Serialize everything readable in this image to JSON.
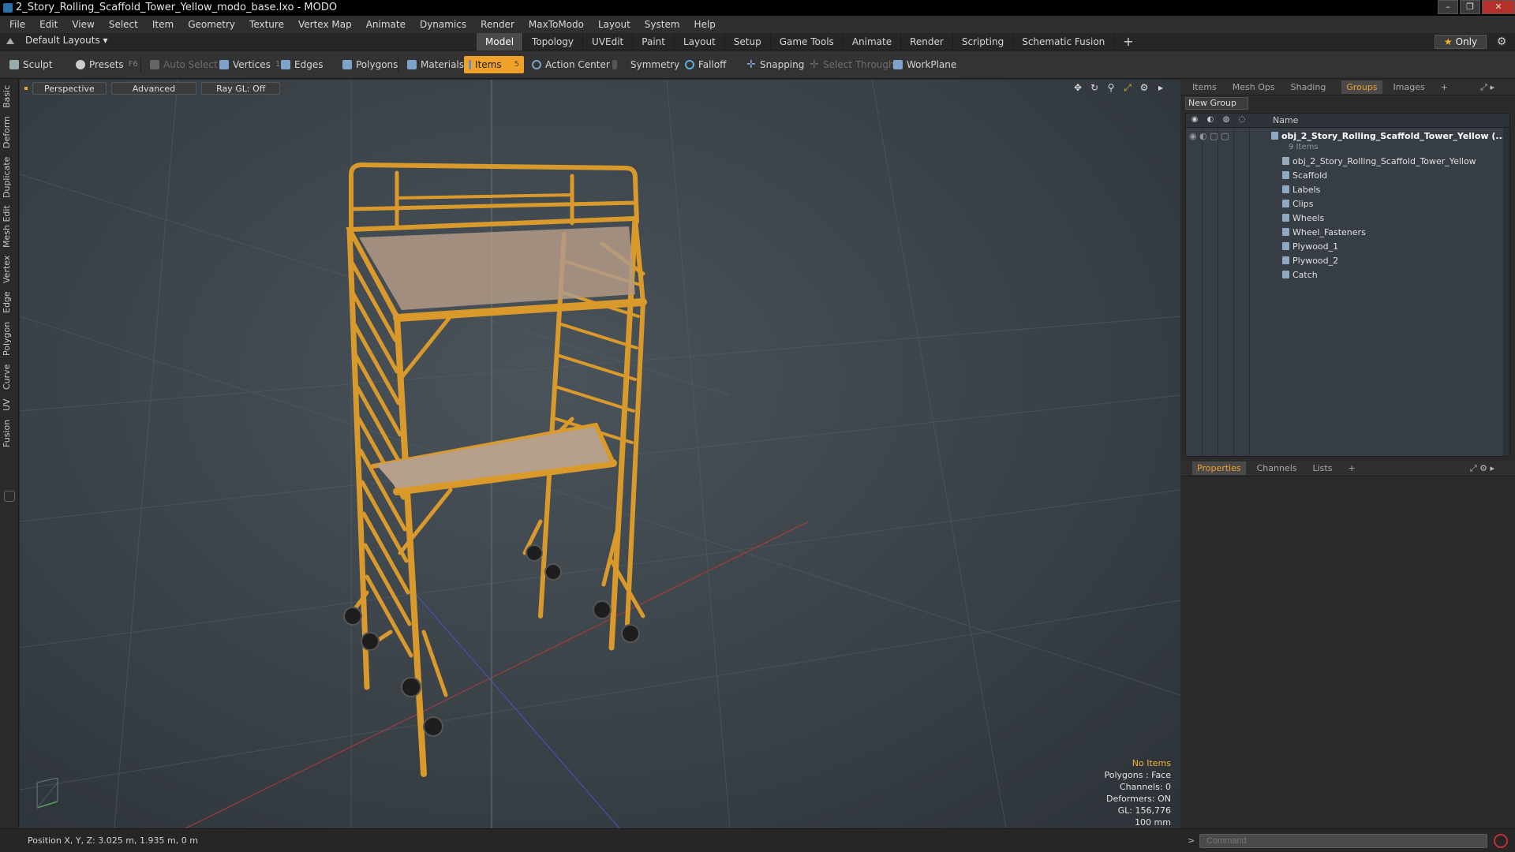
{
  "window": {
    "title": "2_Story_Rolling_Scaffold_Tower_Yellow_modo_base.lxo - MODO",
    "controls": [
      "–",
      "❐",
      "✕"
    ]
  },
  "menu": [
    "File",
    "Edit",
    "View",
    "Select",
    "Item",
    "Geometry",
    "Texture",
    "Vertex Map",
    "Animate",
    "Dynamics",
    "Render",
    "MaxToModo",
    "Layout",
    "System",
    "Help"
  ],
  "layouts": {
    "label": "Default Layouts ▾"
  },
  "mode_tabs": [
    "Model",
    "Topology",
    "UVEdit",
    "Paint",
    "Layout",
    "Setup",
    "Game Tools",
    "Animate",
    "Render",
    "Scripting",
    "Schematic Fusion",
    "+"
  ],
  "only_button": {
    "star": "★",
    "label": "Only"
  },
  "toolbar": {
    "sculpt": "Sculpt",
    "presets": "Presets",
    "presets_key": "F6",
    "auto_select": "Auto Select",
    "vertices": "Vertices",
    "vertices_key": "1",
    "edges": "Edges",
    "edges_key": "2",
    "polygons": "Polygons",
    "materials": "Materials",
    "items": "Items",
    "items_key": "5",
    "action_center": "Action Center",
    "symmetry": "Symmetry",
    "falloff": "Falloff",
    "snapping": "Snapping",
    "select_through": "Select Through",
    "workplane": "WorkPlane"
  },
  "left_tabs": [
    "Basic",
    "Deform",
    "Duplicate",
    "Mesh Edit",
    "Vertex",
    "Edge",
    "Polygon",
    "Curve",
    "UV",
    "Fusion"
  ],
  "viewport": {
    "buttons": [
      "Perspective",
      "Advanced",
      "Ray GL: Off"
    ],
    "stats": {
      "no_items": "No Items",
      "polygons": "Polygons : Face",
      "channels": "Channels: 0",
      "deformers": "Deformers: ON",
      "gl": "GL: 156,776",
      "scale": "100 mm"
    }
  },
  "colors": {
    "accent": "#f0a12a",
    "scaffold": "#d99a2b",
    "plywood": "#b29a86"
  },
  "outliner": {
    "tabs": [
      "Items",
      "Mesh Ops",
      "Shading",
      "Groups",
      "Images",
      "+"
    ],
    "active_tab": "Groups",
    "new_group": "New Group",
    "column_name": "Name",
    "root": "obj_2_Story_Rolling_Scaffold_Tower_Yellow (...",
    "root_count": "9 Items",
    "items": [
      "obj_2_Story_Rolling_Scaffold_Tower_Yellow",
      "Scaffold",
      "Labels",
      "Clips",
      "Wheels",
      "Wheel_Fasteners",
      "Plywood_1",
      "Plywood_2",
      "Catch"
    ]
  },
  "properties": {
    "tabs": [
      "Properties",
      "Channels",
      "Lists",
      "+"
    ],
    "active_tab": "Properties"
  },
  "status": {
    "position": "Position X, Y, Z:   3.025 m, 1.935 m, 0 m",
    "command_placeholder": "Command",
    "prompt": ">"
  }
}
